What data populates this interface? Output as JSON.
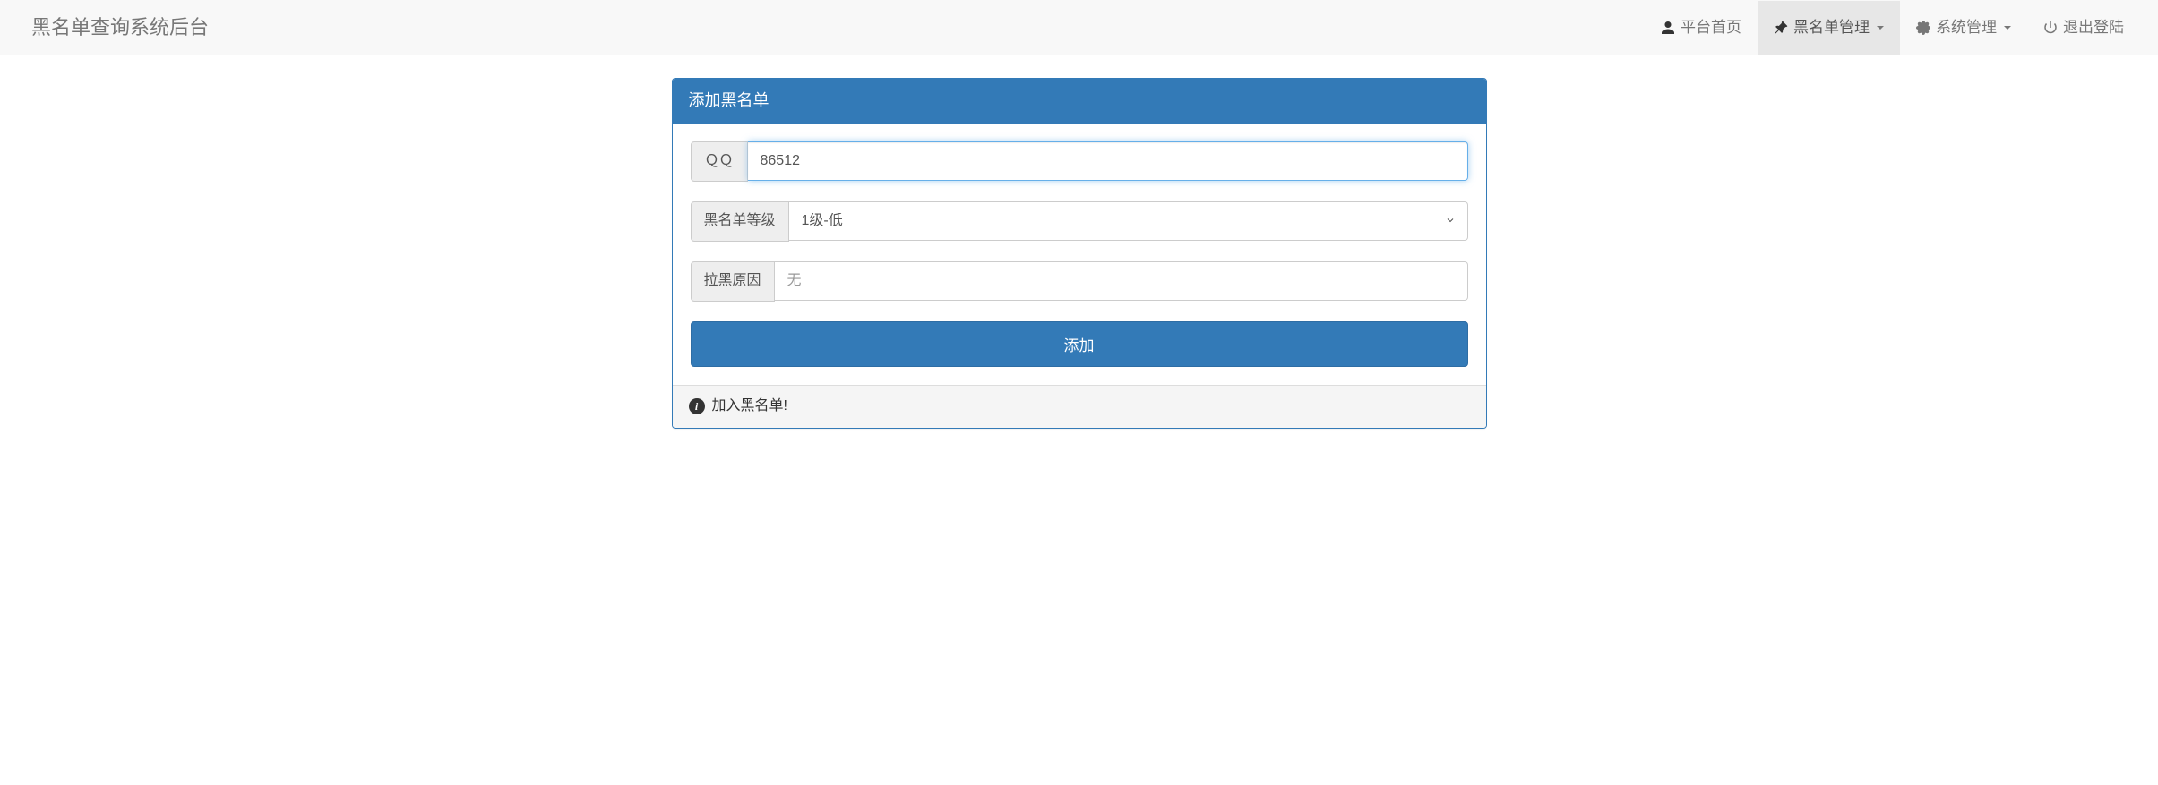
{
  "navbar": {
    "brand": "黑名单查询系统后台",
    "items": [
      {
        "label": "平台首页",
        "icon": "user-icon"
      },
      {
        "label": "黑名单管理",
        "icon": "pin-icon",
        "dropdown": true,
        "active": true
      },
      {
        "label": "系统管理",
        "icon": "gear-icon",
        "dropdown": true
      },
      {
        "label": "退出登陆",
        "icon": "power-icon"
      }
    ]
  },
  "panel": {
    "title": "添加黑名单",
    "footer": "加入黑名单!"
  },
  "form": {
    "qq": {
      "label": "ＱＱ",
      "value": "86512"
    },
    "level": {
      "label": "黑名单等级",
      "selected": "1级-低"
    },
    "reason": {
      "label": "拉黑原因",
      "placeholder": "无",
      "value": ""
    },
    "submit": "添加"
  }
}
